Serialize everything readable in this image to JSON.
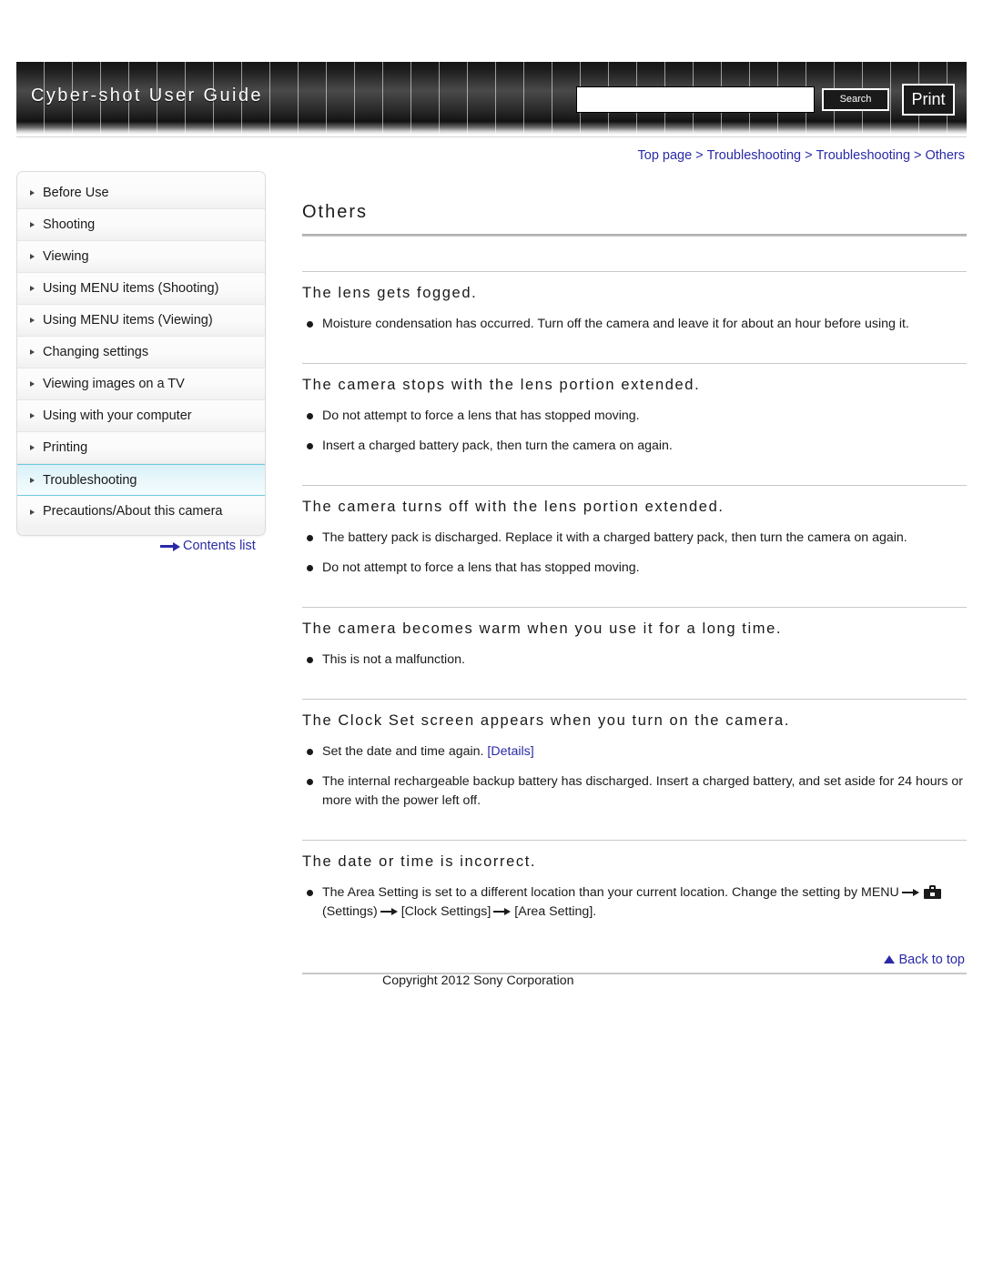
{
  "header": {
    "title": "Cyber-shot User Guide",
    "search_value": "",
    "search_placeholder": "",
    "search_button": "Search",
    "print_button": "Print"
  },
  "breadcrumb": {
    "items": [
      "Top page",
      "Troubleshooting",
      "Troubleshooting",
      "Others"
    ],
    "separator": ">"
  },
  "sidebar": {
    "items": [
      {
        "label": "Before Use",
        "active": false
      },
      {
        "label": "Shooting",
        "active": false
      },
      {
        "label": "Viewing",
        "active": false
      },
      {
        "label": "Using MENU items (Shooting)",
        "active": false
      },
      {
        "label": "Using MENU items (Viewing)",
        "active": false
      },
      {
        "label": "Changing settings",
        "active": false
      },
      {
        "label": "Viewing images on a TV",
        "active": false
      },
      {
        "label": "Using with your computer",
        "active": false
      },
      {
        "label": "Printing",
        "active": false
      },
      {
        "label": "Troubleshooting",
        "active": true
      },
      {
        "label": "Precautions/About this camera",
        "active": false
      }
    ],
    "contents_list_label": "Contents list"
  },
  "main": {
    "page_title": "Others",
    "sections": [
      {
        "heading": "The lens gets fogged.",
        "bullets": [
          {
            "text": "Moisture condensation has occurred. Turn off the camera and leave it for about an hour before using it."
          }
        ]
      },
      {
        "heading": "The camera stops with the lens portion extended.",
        "bullets": [
          {
            "text": "Do not attempt to force a lens that has stopped moving."
          },
          {
            "text": "Insert a charged battery pack, then turn the camera on again."
          }
        ]
      },
      {
        "heading": "The camera turns off with the lens portion extended.",
        "bullets": [
          {
            "text": "The battery pack is discharged. Replace it with a charged battery pack, then turn the camera on again."
          },
          {
            "text": "Do not attempt to force a lens that has stopped moving."
          }
        ]
      },
      {
        "heading": "The camera becomes warm when you use it for a long time.",
        "bullets": [
          {
            "text": "This is not a malfunction."
          }
        ]
      },
      {
        "heading": "The Clock Set screen appears when you turn on the camera.",
        "bullets": [
          {
            "text": "Set the date and time again.",
            "link": "[Details]"
          },
          {
            "text": "The internal rechargeable backup battery has discharged. Insert a charged battery, and set aside for 24 hours or more with the power left off."
          }
        ]
      },
      {
        "heading": "The date or time is incorrect.",
        "bullets": [
          {
            "text_before": "The Area Setting is set to a different location than your current location. Change the setting by MENU",
            "settings_label": "(Settings)",
            "step_1": "[Clock Settings]",
            "step_2": "[Area Setting]."
          }
        ]
      }
    ]
  },
  "footer": {
    "back_to_top": "Back to top",
    "copyright": "Copyright 2012 Sony Corporation"
  },
  "colors": {
    "link": "#2a2aa8",
    "active_nav": "#d9f1f7",
    "banner_dark": "#1a1a1a"
  }
}
